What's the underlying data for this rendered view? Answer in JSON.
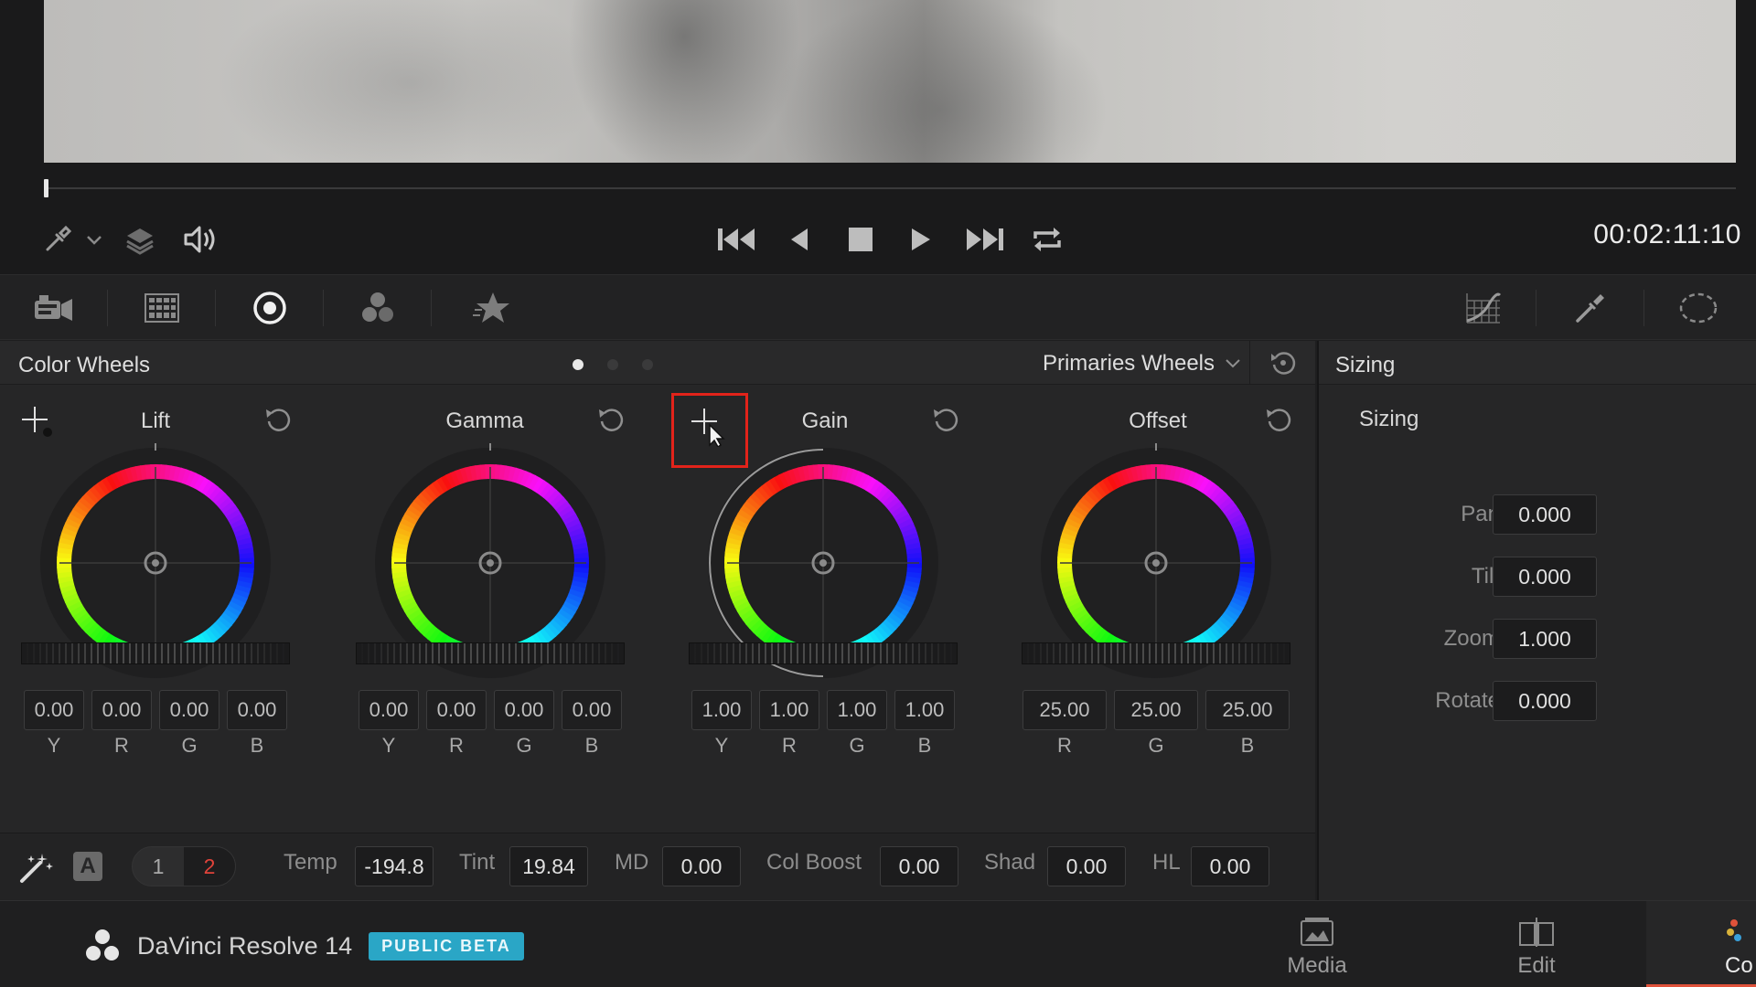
{
  "viewer": {
    "timecode": "00:02:11:10"
  },
  "transport": {
    "icons": [
      "picker-icon",
      "chevron-down-icon",
      "layers-icon",
      "speaker-icon",
      "skip-start-icon",
      "step-back-icon",
      "stop-icon",
      "play-icon",
      "skip-end-icon",
      "loop-icon"
    ]
  },
  "palette": {
    "icons": [
      "camera-raw-icon",
      "color-match-icon",
      "color-wheels-icon",
      "rgb-mixer-icon",
      "motion-effects-icon",
      "curves-icon",
      "qualifier-icon",
      "window-icon"
    ],
    "active": "color-wheels-icon"
  },
  "color_wheels": {
    "title": "Color Wheels",
    "mode": "Primaries Wheels",
    "wheels": [
      {
        "label": "Lift",
        "values": [
          "0.00",
          "0.00",
          "0.00",
          "0.00"
        ],
        "channels": [
          "Y",
          "R",
          "G",
          "B"
        ]
      },
      {
        "label": "Gamma",
        "values": [
          "0.00",
          "0.00",
          "0.00",
          "0.00"
        ],
        "channels": [
          "Y",
          "R",
          "G",
          "B"
        ]
      },
      {
        "label": "Gain",
        "values": [
          "1.00",
          "1.00",
          "1.00",
          "1.00"
        ],
        "channels": [
          "Y",
          "R",
          "G",
          "B"
        ]
      },
      {
        "label": "Offset",
        "values": [
          "25.00",
          "25.00",
          "25.00"
        ],
        "channels": [
          "R",
          "G",
          "B"
        ]
      }
    ]
  },
  "params": {
    "auto_label": "A",
    "page1": "1",
    "page2": "2",
    "temp_label": "Temp",
    "temp": "-194.8",
    "tint_label": "Tint",
    "tint": "19.84",
    "md_label": "MD",
    "md": "0.00",
    "colboost_label": "Col Boost",
    "colboost": "0.00",
    "shad_label": "Shad",
    "shad": "0.00",
    "hl_label": "HL",
    "hl": "0.00",
    "active_page_color": "#e0433a"
  },
  "sizing": {
    "title": "Sizing",
    "subtitle": "Sizing",
    "rows": [
      {
        "label": "Pan",
        "value": "0.000"
      },
      {
        "label": "Tilt",
        "value": "0.000"
      },
      {
        "label": "Zoom",
        "value": "1.000"
      },
      {
        "label": "Rotate",
        "value": "0.000"
      }
    ]
  },
  "footer": {
    "app_name": "DaVinci Resolve 14",
    "badge": "PUBLIC BETA",
    "badge_color": "#2aa6c6",
    "pages": [
      {
        "label": "Media"
      },
      {
        "label": "Edit"
      },
      {
        "label": "Co"
      }
    ]
  }
}
